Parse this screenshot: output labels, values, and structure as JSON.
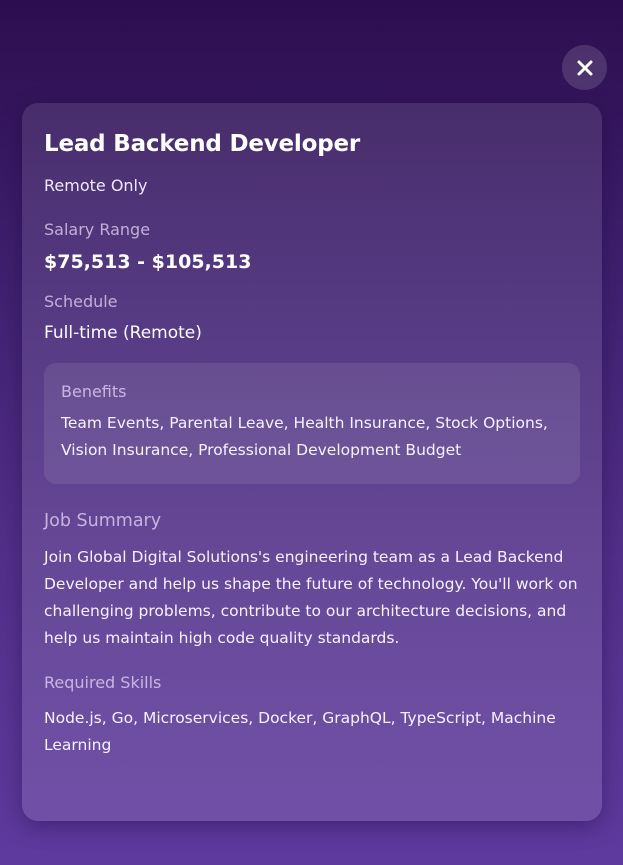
{
  "close_button": {
    "icon": "close-icon",
    "label": "Close"
  },
  "job": {
    "title": "Lead Backend Developer",
    "location": "Remote Only",
    "salary": {
      "label": "Salary Range",
      "value": "$75,513 - $105,513"
    },
    "schedule": {
      "label": "Schedule",
      "value": "Full-time (Remote)"
    },
    "benefits": {
      "label": "Benefits",
      "value": "Team Events, Parental Leave, Health Insurance, Stock Options, Vision Insurance, Professional Development Budget"
    },
    "summary": {
      "label": "Job Summary",
      "value": "Join Global Digital Solutions's engineering team as a Lead Backend Developer and help us shape the future of technology. You'll work on challenging problems, contribute to our architecture decisions, and help us maintain high code quality standards."
    },
    "skills": {
      "label": "Required Skills",
      "value": "Node.js, Go, Microservices, Docker, GraphQL, TypeScript, Machine Learning"
    }
  },
  "colors": {
    "background_top": "#2c0e4f",
    "background_bottom": "#5e3a9e",
    "text": "#ffffff"
  }
}
